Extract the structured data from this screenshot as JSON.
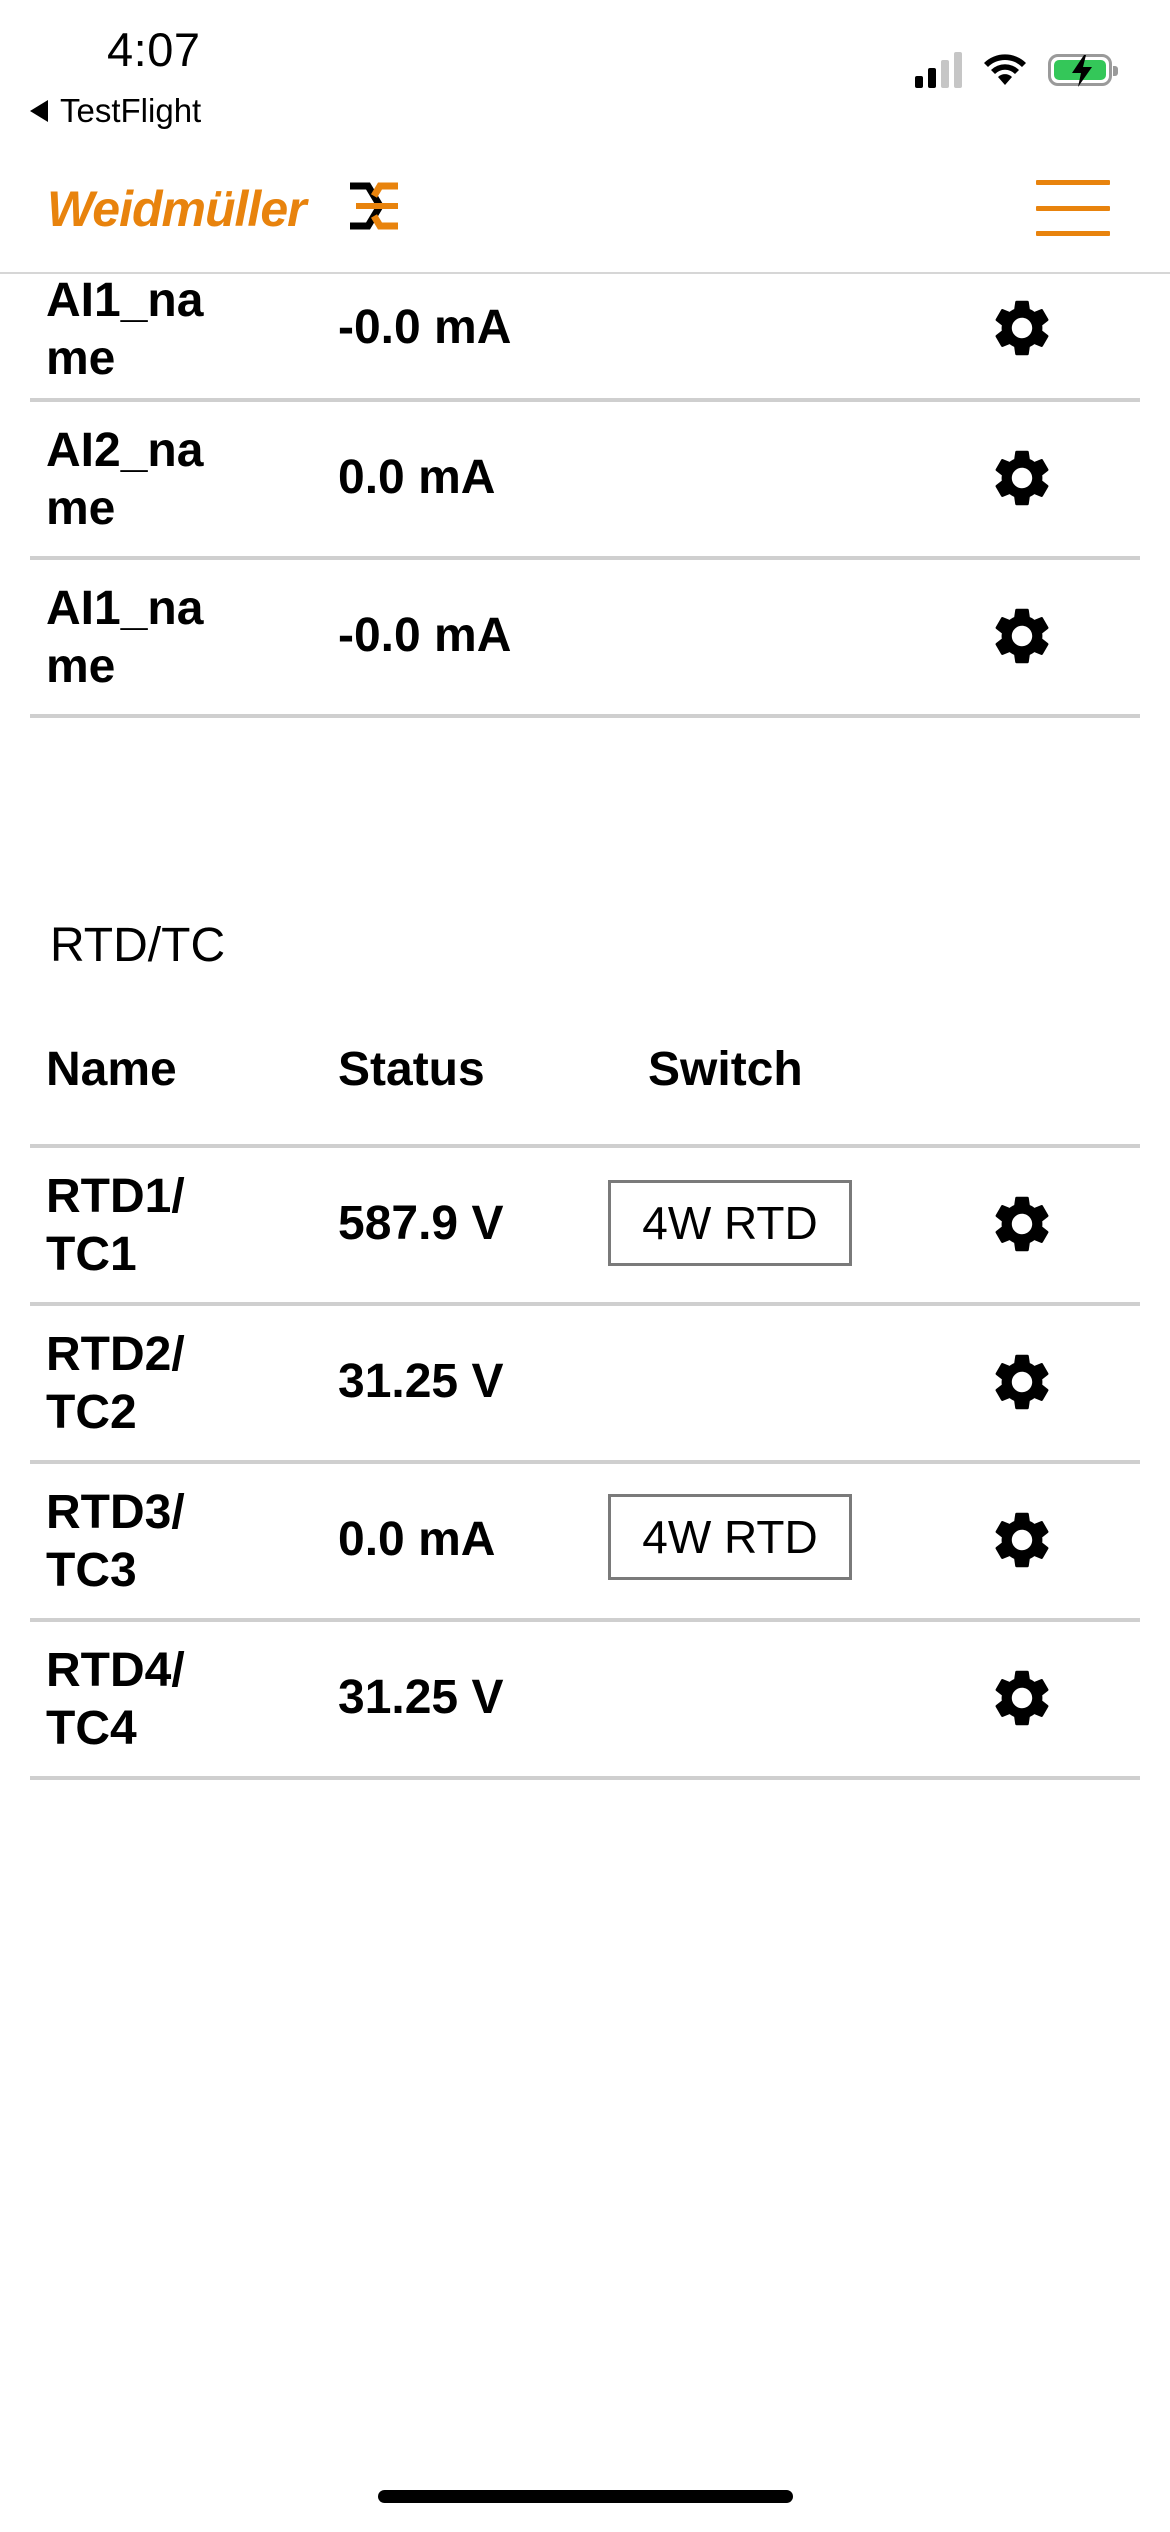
{
  "status_bar": {
    "time": "4:07",
    "back_label": "TestFlight",
    "icons": [
      "signal-icon",
      "wifi-icon",
      "battery-charging-icon"
    ],
    "battery_color": "#34c759"
  },
  "header": {
    "logo_text": "Weidmüller",
    "logo_mark_icon": "weidmuller-mark-icon",
    "menu_icon": "hamburger-menu-icon",
    "brand_color": "#e8830d"
  },
  "ai_rows": [
    {
      "name": "AI1_na\nme",
      "status": "-0.0 mA"
    },
    {
      "name": "AI2_na\nme",
      "status": "0.0 mA"
    },
    {
      "name": "AI1_na\nme",
      "status": "-0.0 mA"
    }
  ],
  "rtd_section": {
    "title": "RTD/TC",
    "headers": {
      "name": "Name",
      "status": "Status",
      "switch": "Switch"
    },
    "rows": [
      {
        "name": "RTD1/\nTC1",
        "status": "587.9 V",
        "switch": "4W RTD"
      },
      {
        "name": "RTD2/\nTC2",
        "status": "31.25 V",
        "switch": ""
      },
      {
        "name": "RTD3/\nTC3",
        "status": "0.0 mA",
        "switch": "4W RTD"
      },
      {
        "name": "RTD4/\nTC4",
        "status": "31.25 V",
        "switch": ""
      }
    ]
  }
}
